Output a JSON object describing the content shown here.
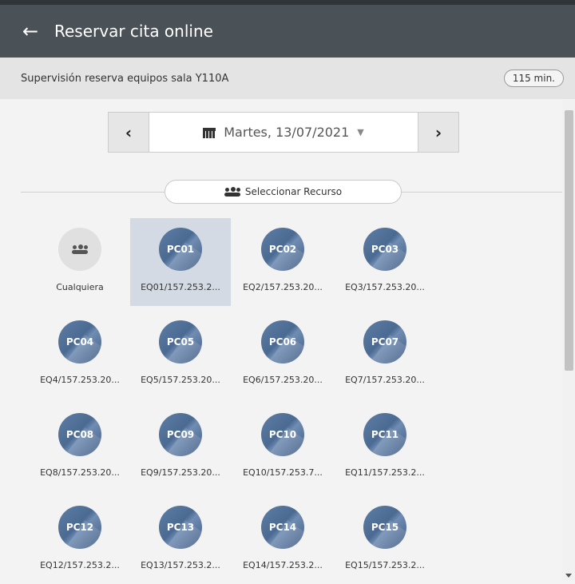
{
  "header": {
    "back_icon": "arrow-left-icon",
    "title": "Reservar cita online"
  },
  "service": {
    "name": "Supervisión reserva equipos sala Y110A",
    "duration": "115 min."
  },
  "date_nav": {
    "prev_icon": "chevron-left-icon",
    "next_icon": "chevron-right-icon",
    "date": "Martes, 13/07/2021",
    "calendar_icon": "calendar-icon",
    "caret_icon": "chevron-down-icon"
  },
  "resource_selector": {
    "label": "Seleccionar Recurso",
    "icon": "users-icon"
  },
  "resources": [
    {
      "code": "",
      "label": "Cualquiera"
    },
    {
      "code": "PC01",
      "label": "EQ01/157.253.2..."
    },
    {
      "code": "PC02",
      "label": "EQ2/157.253.20..."
    },
    {
      "code": "PC03",
      "label": "EQ3/157.253.20..."
    },
    {
      "code": "PC04",
      "label": "EQ4/157.253.20..."
    },
    {
      "code": "PC05",
      "label": "EQ5/157.253.20..."
    },
    {
      "code": "PC06",
      "label": "EQ6/157.253.20..."
    },
    {
      "code": "PC07",
      "label": "EQ7/157.253.20..."
    },
    {
      "code": "PC08",
      "label": "EQ8/157.253.20..."
    },
    {
      "code": "PC09",
      "label": "EQ9/157.253.20..."
    },
    {
      "code": "PC10",
      "label": "EQ10/157.253.7..."
    },
    {
      "code": "PC11",
      "label": "EQ11/157.253.2..."
    },
    {
      "code": "PC12",
      "label": "EQ12/157.253.2..."
    },
    {
      "code": "PC13",
      "label": "EQ13/157.253.2..."
    },
    {
      "code": "PC14",
      "label": "EQ14/157.253.2..."
    },
    {
      "code": "PC15",
      "label": "EQ15/157.253.2..."
    }
  ],
  "selected_resource": "PC01"
}
